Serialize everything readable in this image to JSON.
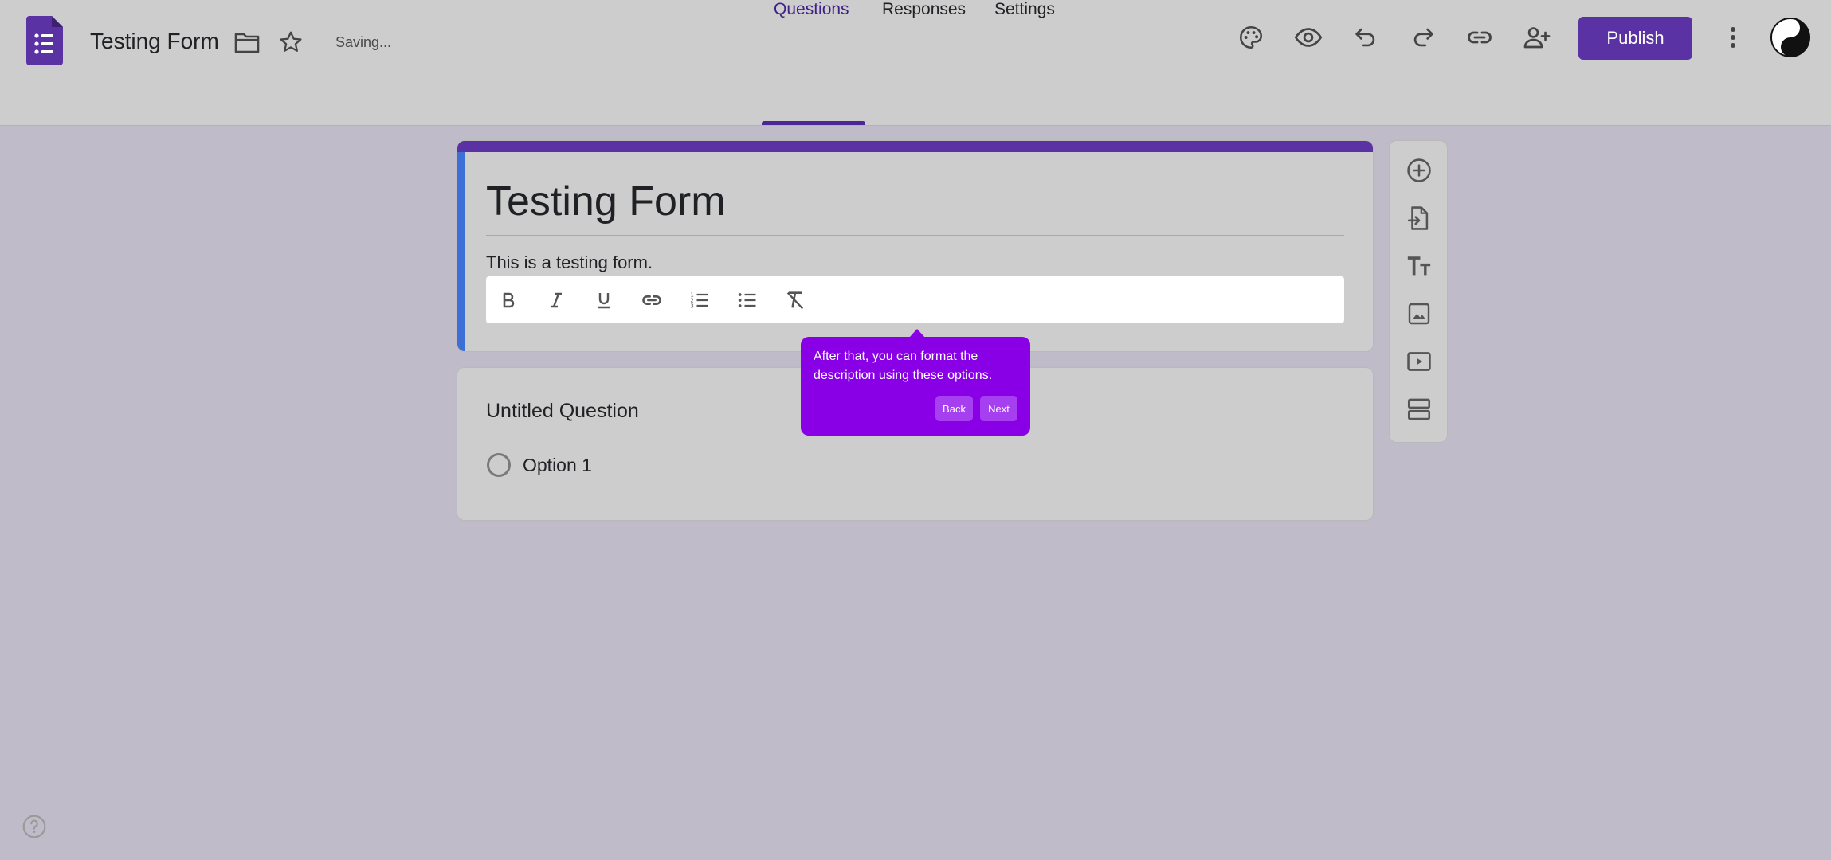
{
  "app": {
    "doc_title": "Testing Form",
    "status": "Saving...",
    "publish_label": "Publish"
  },
  "tabs": [
    {
      "label": "Questions",
      "active": true
    },
    {
      "label": "Responses",
      "active": false
    },
    {
      "label": "Settings",
      "active": false
    }
  ],
  "form": {
    "title": "Testing Form",
    "description": "This is a testing form."
  },
  "format_toolbar": [
    "bold-icon",
    "italic-icon",
    "underline-icon",
    "link-icon",
    "numbered-list-icon",
    "bulleted-list-icon",
    "clear-formatting-icon"
  ],
  "question": {
    "title": "Untitled Question",
    "options": [
      "Option 1"
    ]
  },
  "side_toolbar": [
    "add-question-icon",
    "import-questions-icon",
    "add-title-icon",
    "add-image-icon",
    "add-video-icon",
    "add-section-icon"
  ],
  "tooltip": {
    "text": "After that, you can format the description using these options.",
    "back_label": "Back",
    "next_label": "Next"
  },
  "colors": {
    "brand": "#5b32a3",
    "tooltip": "#8a00e6",
    "accent_stripe": "#3d6fd6"
  }
}
